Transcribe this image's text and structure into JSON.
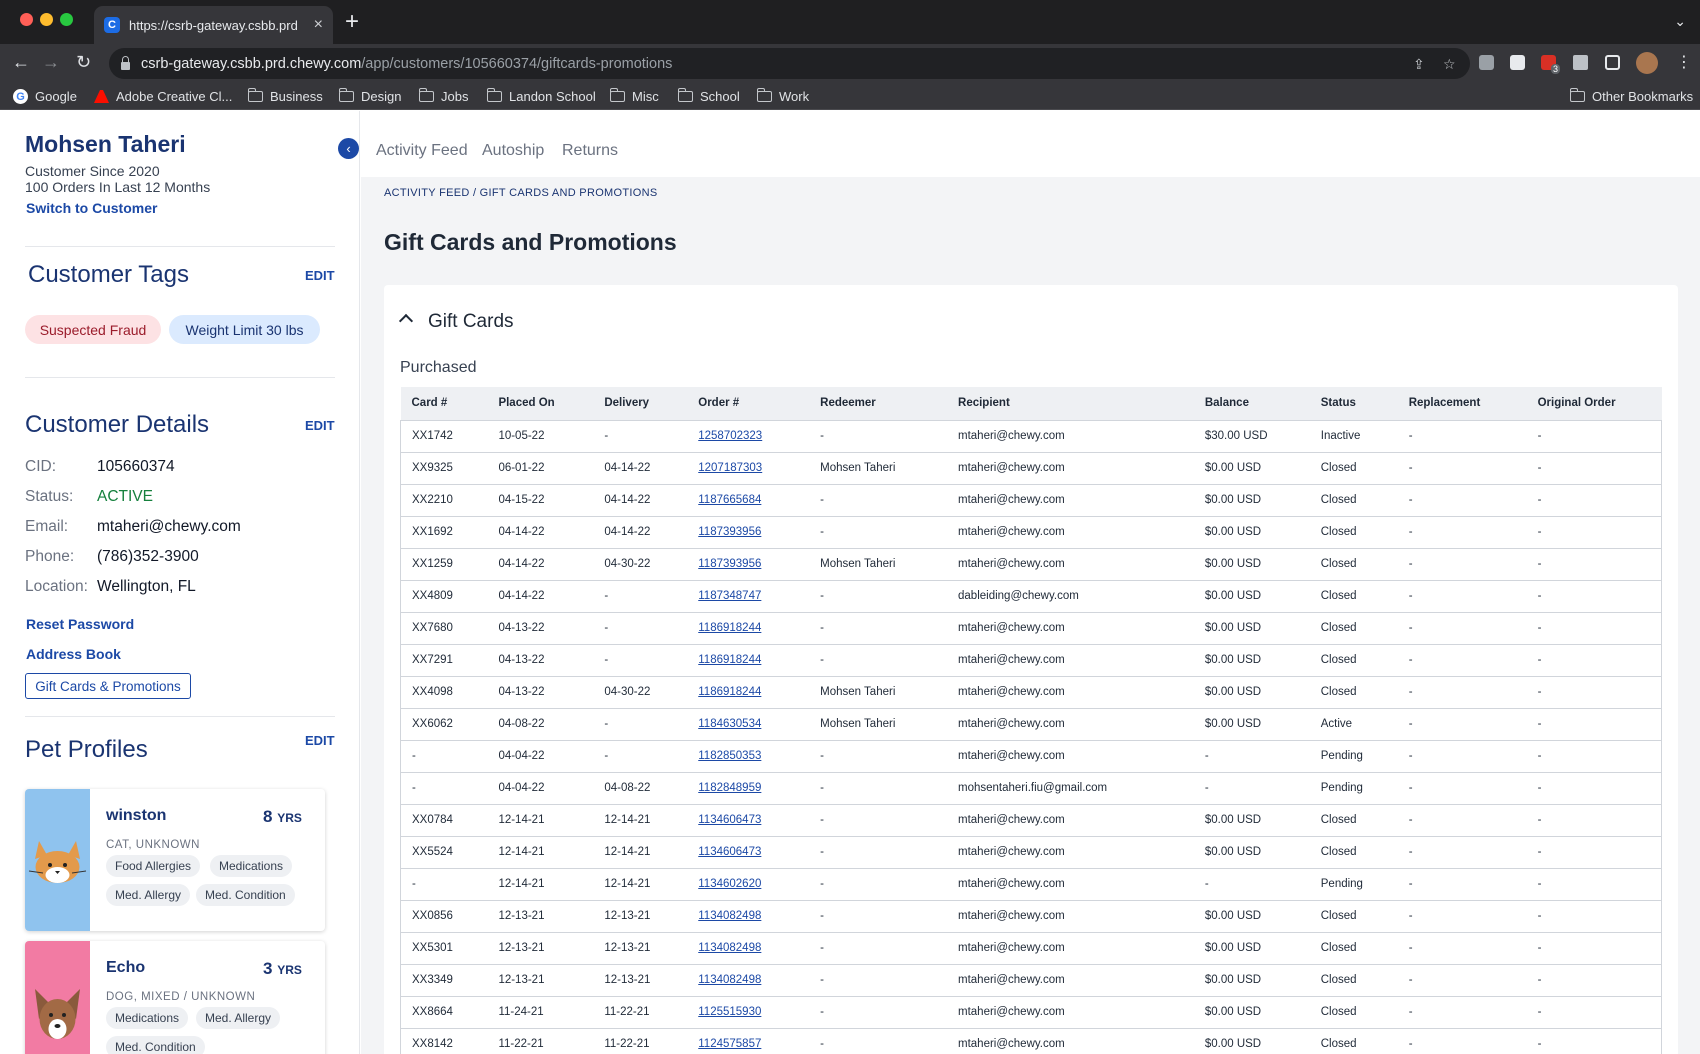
{
  "browser": {
    "tab_title": "https://csrb-gateway.csbb.prd",
    "favicon_letter": "C",
    "url_host": "csrb-gateway.csbb.prd.chewy.com",
    "url_path": "/app/customers/105660374/giftcards-promotions",
    "extension_badge": "3",
    "bookmarks": [
      "Google",
      "Adobe Creative Cl...",
      "Business",
      "Design",
      "Jobs",
      "Landon School",
      "Misc",
      "School",
      "Work"
    ],
    "other_bookmarks": "Other Bookmarks"
  },
  "customer": {
    "name": "Mohsen Taheri",
    "since": "Customer Since 2020",
    "orders": "100 Orders In Last 12 Months",
    "switch_label": "Switch to Customer"
  },
  "tags": {
    "title": "Customer Tags",
    "edit": "EDIT",
    "items": [
      "Suspected Fraud",
      "Weight Limit 30 lbs"
    ]
  },
  "details": {
    "title": "Customer Details",
    "edit": "EDIT",
    "cid_label": "CID:",
    "cid": "105660374",
    "status_label": "Status:",
    "status": "ACTIVE",
    "email_label": "Email:",
    "email": "mtaheri@chewy.com",
    "phone_label": "Phone:",
    "phone": "(786)352-3900",
    "location_label": "Location:",
    "location": "Wellington, FL",
    "reset_password": "Reset Password",
    "address_book": "Address Book",
    "gift_cards": "Gift Cards & Promotions"
  },
  "pets": {
    "title": "Pet Profiles",
    "edit": "EDIT",
    "items": [
      {
        "name": "winston",
        "age": "8",
        "unit": "YRS",
        "breed": "CAT, UNKNOWN",
        "chips": [
          "Food Allergies",
          "Medications",
          "Med. Allergy",
          "Med. Condition"
        ]
      },
      {
        "name": "Echo",
        "age": "3",
        "unit": "YRS",
        "breed": "DOG, MIXED / UNKNOWN",
        "chips": [
          "Medications",
          "Med. Allergy",
          "Med. Condition"
        ]
      }
    ]
  },
  "topnav": [
    "Activity Feed",
    "Autoship",
    "Returns"
  ],
  "breadcrumb": "ACTIVITY FEED / GIFT CARDS AND PROMOTIONS",
  "page_title": "Gift Cards and Promotions",
  "gift_cards": {
    "section_title": "Gift Cards",
    "subtitle": "Purchased",
    "columns": [
      "Card #",
      "Placed On",
      "Delivery",
      "Order #",
      "Redeemer",
      "Recipient",
      "Balance",
      "Status",
      "Replacement",
      "Original Order"
    ],
    "rows": [
      [
        "XX1742",
        "10-05-22",
        "-",
        "1258702323",
        "-",
        "mtaheri@chewy.com",
        "$30.00 USD",
        "Inactive",
        "-",
        "-"
      ],
      [
        "XX9325",
        "06-01-22",
        "04-14-22",
        "1207187303",
        "Mohsen Taheri",
        "mtaheri@chewy.com",
        "$0.00 USD",
        "Closed",
        "-",
        "-"
      ],
      [
        "XX2210",
        "04-15-22",
        "04-14-22",
        "1187665684",
        "-",
        "mtaheri@chewy.com",
        "$0.00 USD",
        "Closed",
        "-",
        "-"
      ],
      [
        "XX1692",
        "04-14-22",
        "04-14-22",
        "1187393956",
        "-",
        "mtaheri@chewy.com",
        "$0.00 USD",
        "Closed",
        "-",
        "-"
      ],
      [
        "XX1259",
        "04-14-22",
        "04-30-22",
        "1187393956",
        "Mohsen Taheri",
        "mtaheri@chewy.com",
        "$0.00 USD",
        "Closed",
        "-",
        "-"
      ],
      [
        "XX4809",
        "04-14-22",
        "-",
        "1187348747",
        "-",
        "dableiding@chewy.com",
        "$0.00 USD",
        "Closed",
        "-",
        "-"
      ],
      [
        "XX7680",
        "04-13-22",
        "-",
        "1186918244",
        "-",
        "mtaheri@chewy.com",
        "$0.00 USD",
        "Closed",
        "-",
        "-"
      ],
      [
        "XX7291",
        "04-13-22",
        "-",
        "1186918244",
        "-",
        "mtaheri@chewy.com",
        "$0.00 USD",
        "Closed",
        "-",
        "-"
      ],
      [
        "XX4098",
        "04-13-22",
        "04-30-22",
        "1186918244",
        "Mohsen Taheri",
        "mtaheri@chewy.com",
        "$0.00 USD",
        "Closed",
        "-",
        "-"
      ],
      [
        "XX6062",
        "04-08-22",
        "-",
        "1184630534",
        "Mohsen Taheri",
        "mtaheri@chewy.com",
        "$0.00 USD",
        "Active",
        "-",
        "-"
      ],
      [
        "-",
        "04-04-22",
        "-",
        "1182850353",
        "-",
        "mtaheri@chewy.com",
        "-",
        "Pending",
        "-",
        "-"
      ],
      [
        "-",
        "04-04-22",
        "04-08-22",
        "1182848959",
        "-",
        "mohsentaheri.fiu@gmail.com",
        "-",
        "Pending",
        "-",
        "-"
      ],
      [
        "XX0784",
        "12-14-21",
        "12-14-21",
        "1134606473",
        "-",
        "mtaheri@chewy.com",
        "$0.00 USD",
        "Closed",
        "-",
        "-"
      ],
      [
        "XX5524",
        "12-14-21",
        "12-14-21",
        "1134606473",
        "-",
        "mtaheri@chewy.com",
        "$0.00 USD",
        "Closed",
        "-",
        "-"
      ],
      [
        "-",
        "12-14-21",
        "12-14-21",
        "1134602620",
        "-",
        "mtaheri@chewy.com",
        "-",
        "Pending",
        "-",
        "-"
      ],
      [
        "XX0856",
        "12-13-21",
        "12-13-21",
        "1134082498",
        "-",
        "mtaheri@chewy.com",
        "$0.00 USD",
        "Closed",
        "-",
        "-"
      ],
      [
        "XX5301",
        "12-13-21",
        "12-13-21",
        "1134082498",
        "-",
        "mtaheri@chewy.com",
        "$0.00 USD",
        "Closed",
        "-",
        "-"
      ],
      [
        "XX3349",
        "12-13-21",
        "12-13-21",
        "1134082498",
        "-",
        "mtaheri@chewy.com",
        "$0.00 USD",
        "Closed",
        "-",
        "-"
      ],
      [
        "XX8664",
        "11-24-21",
        "11-22-21",
        "1125515930",
        "-",
        "mtaheri@chewy.com",
        "$0.00 USD",
        "Closed",
        "-",
        "-"
      ],
      [
        "XX8142",
        "11-22-21",
        "11-22-21",
        "1124575857",
        "-",
        "mtaheri@chewy.com",
        "$0.00 USD",
        "Closed",
        "-",
        "-"
      ]
    ]
  },
  "colors": {
    "brand": "#1c49a6",
    "status_active": "#15803d",
    "tag_fraud": "#fde2e4",
    "tag_weight": "#dbeafe"
  }
}
